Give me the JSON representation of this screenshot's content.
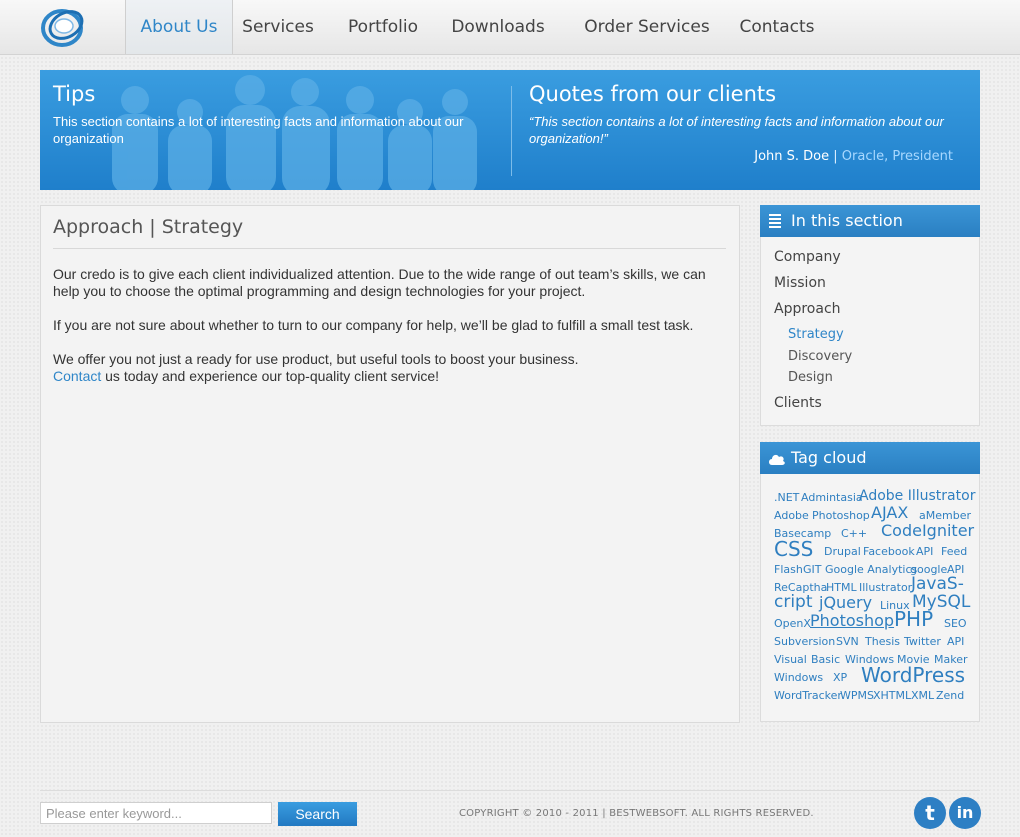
{
  "nav": {
    "items": [
      {
        "label": "About Us",
        "active": true
      },
      {
        "label": "Services"
      },
      {
        "label": "Portfolio"
      },
      {
        "label": "Downloads"
      },
      {
        "label": "Order Services"
      },
      {
        "label": "Contacts"
      }
    ]
  },
  "banner": {
    "tips_title": "Tips",
    "tips_text": "This section contains a lot of interesting facts and information about our organization",
    "quotes_title": "Quotes from our clients",
    "quote_text": "“This section contains a lot of interesting facts and information about our organization!”",
    "quote_author": "John S. Doe",
    "quote_sep": " | ",
    "quote_company": "Oracle, President"
  },
  "content": {
    "title": "Approach | Strategy",
    "para1": "Our credo is to give each client individualized attention.  Due to the wide range of out team’s skills, we can help you to choose the optimal programming and design technologies for your project.",
    "para2": "If you are not sure about whether to turn to our company for help, we’ll be glad to fulfill a small test task.",
    "para3": "We offer you not just a ready for use product, but useful tools to boost your business.",
    "contact_link": "Contact",
    "para4_rest": " us today and experience our top-quality client service!"
  },
  "section": {
    "title": "In this section",
    "items": [
      {
        "label": "Company"
      },
      {
        "label": "Mission"
      },
      {
        "label": "Approach"
      },
      {
        "label": "Strategy",
        "current": true
      },
      {
        "label": "Discovery"
      },
      {
        "label": "Design"
      },
      {
        "label": "Clients"
      }
    ]
  },
  "tags": {
    "title": "Tag cloud",
    "items": [
      ".NET",
      "Admintasia",
      "Adobe Illustrator",
      "Adobe",
      "Photoshop",
      "AJAX",
      "aMember",
      "Basecamp",
      "C++",
      "CodeIgniter",
      "CSS",
      "Drupal",
      "Facebook",
      "API",
      "Feed",
      "Flash",
      "GIT",
      "Google Analytics",
      "google",
      "API",
      "ReCaptha",
      "HTML",
      "Illustrator",
      "JavaS-",
      "cript",
      "jQuery",
      "Linux",
      "MySQL",
      "OpenX",
      "Photoshop",
      "PHP",
      "SEO",
      "Subversion",
      "SVN",
      "Thesis",
      "Twitter",
      "API",
      "Visual",
      "Basic",
      "Windows",
      "Movie",
      "Maker",
      "Windows",
      "XP",
      "WordPress",
      "WordTracker",
      "WPMS",
      "XHTML",
      "XML",
      "Zend"
    ]
  },
  "footer": {
    "search_placeholder": "Please enter keyword...",
    "search_button": "Search",
    "copyright": "COPYRIGHT © 2010 - 2011 | BESTWEBSOFT. ALL RIGHTS RESERVED.",
    "twitter_glyph": "t",
    "linkedin_glyph": "in"
  },
  "colors": {
    "accent": "#2f86c8",
    "banner": "#2a87d2",
    "widget_header": "#2a7fc2"
  }
}
